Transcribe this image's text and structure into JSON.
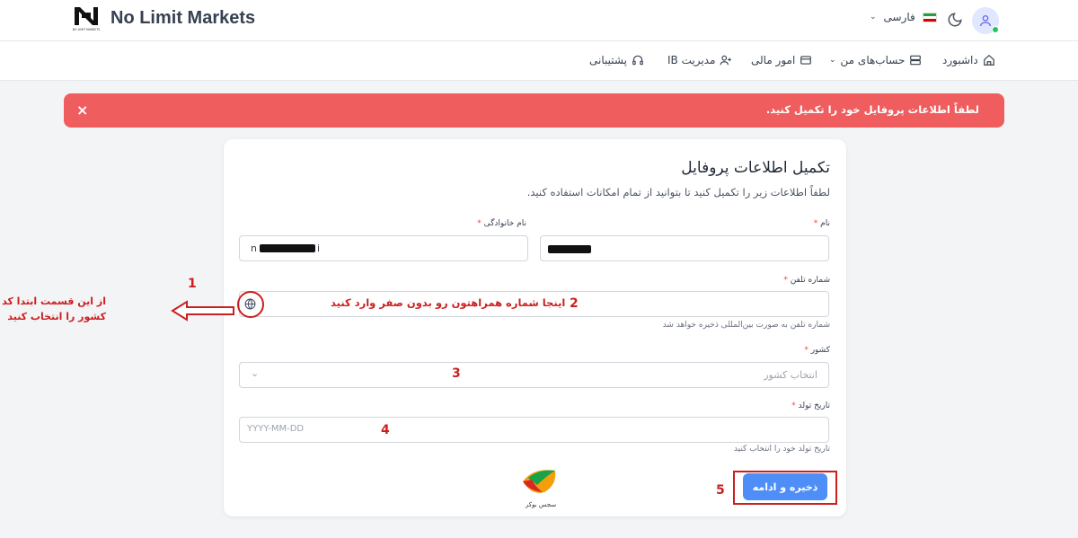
{
  "header": {
    "brand": "No Limit Markets",
    "logo_caption": "NO LIMIT MARKETS",
    "language": "فارسی"
  },
  "nav": {
    "dashboard": "داشبورد",
    "accounts": "حساب‌های من",
    "finance": "امور مالی",
    "ib": "مدیریت IB",
    "support": "پشتیبانی"
  },
  "alert": {
    "message": "لطفاً اطلاعات پروفایل خود را تکمیل کنید.",
    "close": "×"
  },
  "form": {
    "title": "تکمیل اطلاعات پروفایل",
    "subtitle": "لطفاً اطلاعات زیر را تکمیل کنید تا بتوانید از تمام امکانات استفاده کنید.",
    "first_name_label": "نام",
    "last_name_label": "نام خانوادگی",
    "last_name_value_start": "n",
    "last_name_value_end": "i",
    "phone_label": "شماره تلفن",
    "phone_help": "شماره تلفن به صورت بین‌المللی ذخیره خواهد شد",
    "country_label": "کشور",
    "country_placeholder": "انتخاب کشور",
    "birth_label": "تاریخ تولد",
    "birth_placeholder": "YYYY-MM-DD",
    "birth_help": "تاریخ تولد خود را انتخاب کنید",
    "required_mark": "*",
    "save_button": "ذخیره و ادامه"
  },
  "annotations": {
    "n1": "1",
    "n2": "2",
    "n3": "3",
    "n4": "4",
    "n5": "5",
    "step1_line1": "از این قسمت ابتدا کد",
    "step1_line2": "کشور را انتخاب کنید",
    "step2": "اینجا شماره همراهتون رو بدون صفر وارد کنید",
    "watermark": "سجس بوکر"
  },
  "colors": {
    "alert": "#f05d5e",
    "primary_button": "#4f8ef7",
    "annotation_red": "#cc1f1f"
  }
}
